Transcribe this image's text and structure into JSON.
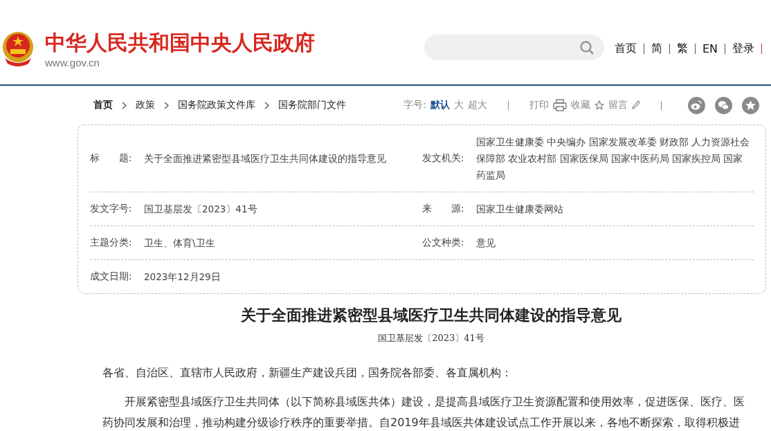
{
  "header": {
    "site_title": "中华人民共和国中央人民政府",
    "site_url": "www.gov.cn",
    "nav_links": [
      "首页",
      "简",
      "繁",
      "EN",
      "登录"
    ]
  },
  "breadcrumb": [
    "首页",
    "政策",
    "国务院政策文件库",
    "国务院部门文件"
  ],
  "toolbar": {
    "font_size_label": "字号:",
    "font_sizes": [
      {
        "label": "默认",
        "selected": true
      },
      {
        "label": "大",
        "selected": false
      },
      {
        "label": "超大",
        "selected": false
      }
    ],
    "print": "打印",
    "favorite": "收藏",
    "comment": "留言"
  },
  "info_table": {
    "rows": [
      [
        {
          "label": "标　　题:",
          "value": "关于全面推进紧密型县域医疗卫生共同体建设的指导意见"
        },
        {
          "label": "发文机关:",
          "value": "国家卫生健康委 中央编办 国家发展改革委 财政部 人力资源社会保障部 农业农村部 国家医保局 国家中医药局 国家疾控局 国家药监局"
        }
      ],
      [
        {
          "label": "发文字号:",
          "value": "国卫基层发〔2023〕41号"
        },
        {
          "label": "来　　源:",
          "value": "国家卫生健康委网站"
        }
      ],
      [
        {
          "label": "主题分类:",
          "value": "卫生、体育\\卫生"
        },
        {
          "label": "公文种类:",
          "value": "意见"
        }
      ],
      [
        {
          "label": "成文日期:",
          "value": "2023年12月29日"
        }
      ]
    ]
  },
  "article": {
    "title": "关于全面推进紧密型县域医疗卫生共同体建设的指导意见",
    "doc_number": "国卫基层发〔2023〕41号",
    "paragraphs": [
      {
        "kind": "salutation",
        "text": "各省、自治区、直辖市人民政府，新疆生产建设兵团，国务院各部委、各直属机构："
      },
      {
        "kind": "body",
        "text": "开展紧密型县域医疗卫生共同体（以下简称县域医共体）建设，是提高县域医疗卫生资源配置和使用效率，促进医保、医疗、医药协同发展和治理，推动构建分级诊疗秩序的重要举措。自2019年县域医共体建设试点工作开展以来，各地不断探索，取得积极进"
      }
    ]
  }
}
